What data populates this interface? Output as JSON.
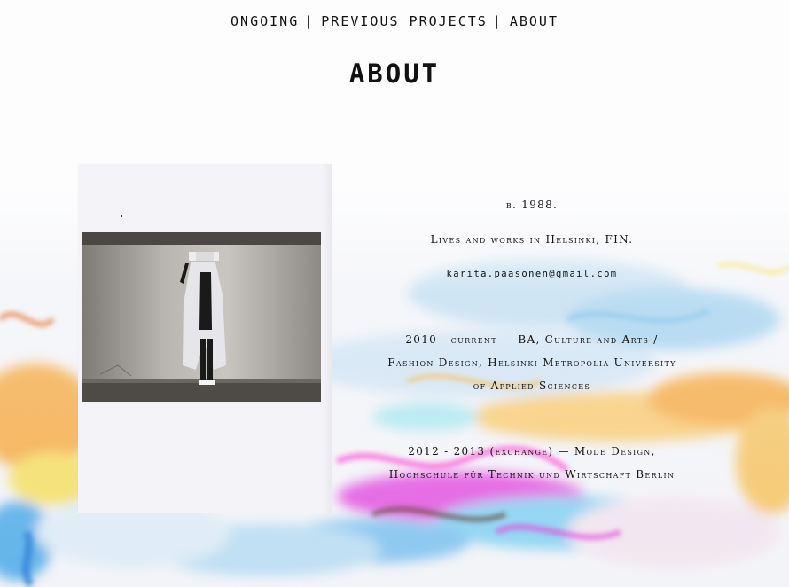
{
  "nav": {
    "items": [
      {
        "label": "ONGOING"
      },
      {
        "label": "PREVIOUS PROJECTS"
      },
      {
        "label": "ABOUT"
      }
    ],
    "separator": "|"
  },
  "page": {
    "title": "ABOUT"
  },
  "bio": {
    "born": "b. 1988.",
    "location": "Lives and works in Helsinki, FIN.",
    "email": "karita.paasonen@gmail.com",
    "education": [
      {
        "lines": [
          "2010 - current — BA, Culture and Arts /",
          "Fashion Design, Helsinki Metropolia University",
          "of Applied Sciences"
        ]
      },
      {
        "lines": [
          "2012 - 2013 (exchange) — Mode Design,",
          "Hochschule für Technik und Wirtschaft Berlin"
        ]
      }
    ]
  },
  "colors": {
    "background": "#fdfdfe",
    "text": "#111111",
    "paint_orange": "#f6a73a",
    "paint_blue": "#4aa9e8",
    "paint_magenta": "#e24be0",
    "paint_yellow": "#f4de5a"
  }
}
